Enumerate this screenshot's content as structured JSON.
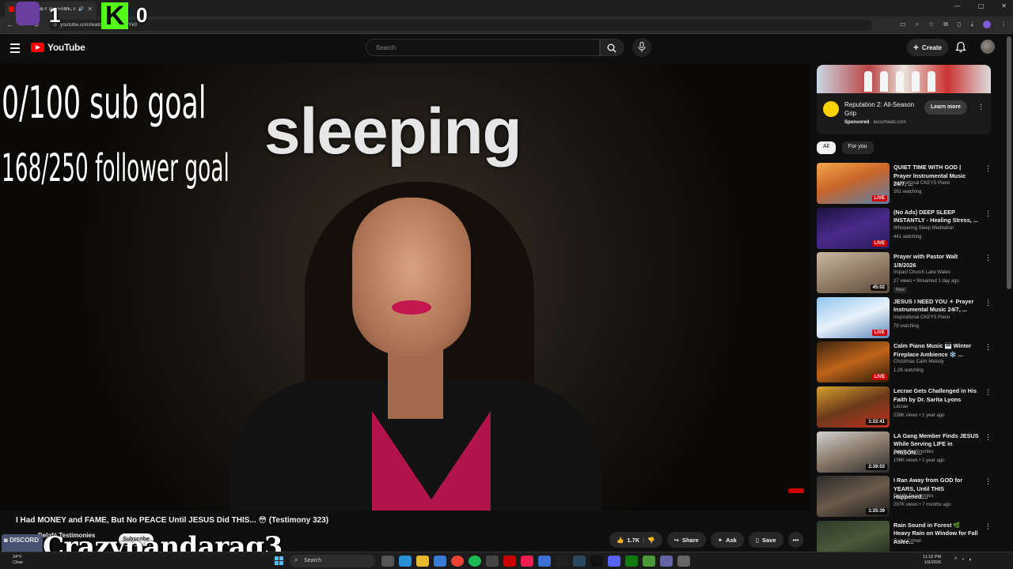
{
  "browser": {
    "tab_title": "I Had MONEY and FAME, B",
    "url": "youtube.com/watch?v=...bey5Yk0"
  },
  "overlay": {
    "count_left": "1",
    "count_right": "0",
    "k_logo": "K",
    "sub_goal": "0/100 sub goal",
    "follower_goal": "168/250 follower goal",
    "status": "sleeping",
    "streamer_name": "Crazypandarag3",
    "discord_label": "DISCORD"
  },
  "header": {
    "logo_text": "YouTube",
    "search_placeholder": "Search",
    "create_label": "Create"
  },
  "video": {
    "title": "I Had MONEY and FAME, But No PEACE Until JESUS Did THIS... 😳 (Testimony 323)",
    "channel": "Delafé Testimonies",
    "subscribe_label": "Subscribe",
    "likes": "1.7K",
    "share_label": "Share",
    "ask_label": "Ask",
    "save_label": "Save"
  },
  "ad": {
    "title": "Reputation 2: All-Season Grip",
    "sponsored": "Sponsored",
    "domain": "lesschwab.com",
    "cta": "Learn more"
  },
  "chips": [
    "All",
    "For you"
  ],
  "recommendations": [
    {
      "title": "QUIET TIME WITH GOD | Prayer Instrumental Music 24/7, ...",
      "channel": "Inspirational CKEYS Piano",
      "meta": "261 watching",
      "badge": "LIVE",
      "live": true,
      "thumb": "linear-gradient(160deg,#f2a64a,#c9652a 45%,#5b7fa8)"
    },
    {
      "title": "(No Ads) DEEP SLEEP INSTANTLY - Healing Stress, ...",
      "channel": "Whispering Sleep Meditation",
      "meta": "441 watching",
      "badge": "LIVE",
      "live": true,
      "thumb": "linear-gradient(160deg,#1a1240,#4a2a8a 50%,#2a1a5a)"
    },
    {
      "title": "Prayer with Pastor Walt 1/8/2026",
      "channel": "Impact Church Lake Wales",
      "meta": "27 views • Streamed 1 day ago",
      "badge": "45:02",
      "live": false,
      "new": "New",
      "thumb": "linear-gradient(160deg,#c8b8a0,#8a7560 60%,#5a4a3a)"
    },
    {
      "title": "JESUS I NEED YOU ☀ Prayer Instrumental Music 24/7, ...",
      "channel": "Inspirational CKEYS Piano",
      "meta": "78 watching",
      "badge": "LIVE",
      "live": true,
      "thumb": "linear-gradient(160deg,#8fc4f0,#e8f2fb 50%,#5a86b8)"
    },
    {
      "title": "Calm Piano Music 🎹 Winter Fireplace Ambience ❄️ ...",
      "channel": "Christmas Calm Melody",
      "meta": "1.2K watching",
      "badge": "LIVE",
      "live": true,
      "thumb": "linear-gradient(160deg,#3a2410,#c0641a 50%,#2a1a0a)"
    },
    {
      "title": "Lecrae Gets Challenged in His Faith by Dr. Sarita Lyons",
      "channel": "Lecrae",
      "meta": "238K views • 1 year ago",
      "badge": "1:22:41",
      "live": false,
      "thumb": "linear-gradient(160deg,#d8a030,#6a3a1a 50%,#c03020)"
    },
    {
      "title": "LA Gang Member Finds JESUS While Serving LIFE in PRISON....",
      "channel": "Delafé Testimonies",
      "meta": "106K views • 1 year ago",
      "badge": "2:39:03",
      "live": false,
      "thumb": "linear-gradient(160deg,#d0d0d0,#8a7a6a 50%,#2a2a2a)"
    },
    {
      "title": "I Ran Away from GOD for YEARS, Until THIS Happened....",
      "channel": "Delafé Testimonies",
      "meta": "297K views • 7 months ago",
      "badge": "1:25:39",
      "live": false,
      "thumb": "linear-gradient(160deg,#2a2a2a,#6a5a4a 50%,#1a1a1a)"
    },
    {
      "title": "Rain Sound in Forest 🌿 Heavy Rain on Window for Fall Aslee...",
      "channel": "Relax Corner",
      "meta": "",
      "badge": "",
      "live": false,
      "thumb": "linear-gradient(160deg,#2a3a2a,#4a5a3a 50%,#1a2418)"
    }
  ],
  "taskbar": {
    "weather_temp": "24°F",
    "weather_desc": "Clear",
    "search_label": "Search",
    "time": "11:16 PM",
    "date": "1/9/2026"
  }
}
